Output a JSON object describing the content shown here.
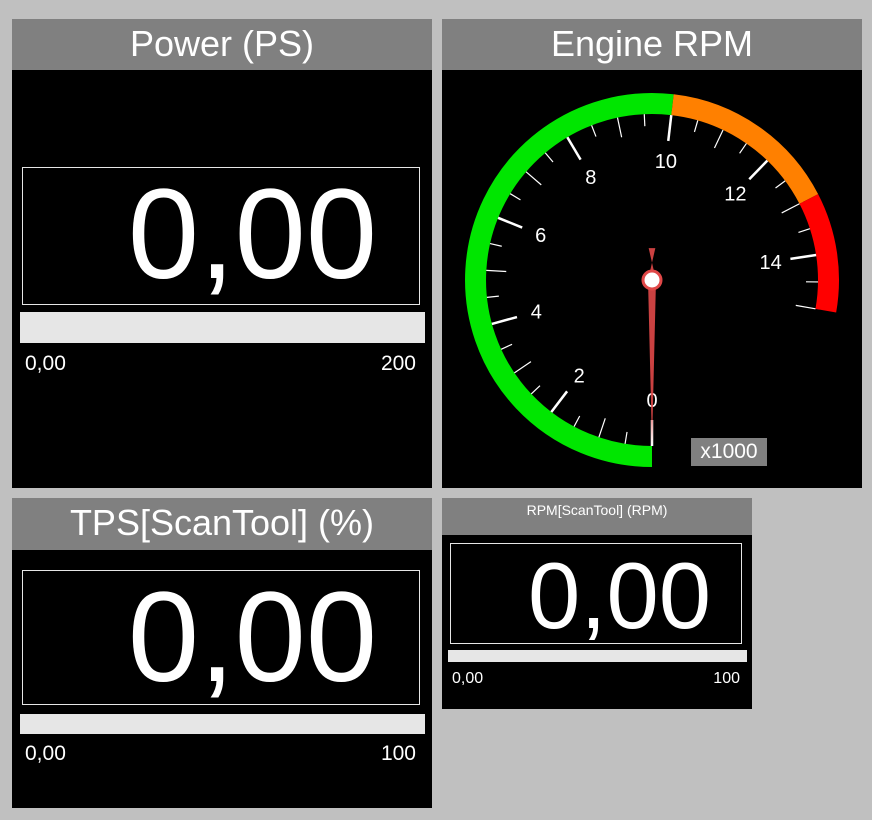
{
  "power": {
    "title": "Power (PS)",
    "value": "0,00",
    "min_label": "0,00",
    "max_label": "200",
    "level_percent": 0
  },
  "rpm_gauge": {
    "title": "Engine RPM",
    "unit_label": "x1000",
    "min": 0,
    "max": 15,
    "needle_value": 0,
    "tick_labels": [
      "0",
      "2",
      "4",
      "6",
      "8",
      "10",
      "12",
      "14"
    ],
    "zones": [
      {
        "from": 0,
        "to": 10,
        "color": "#00e600"
      },
      {
        "from": 10,
        "to": 13,
        "color": "#ff8000"
      },
      {
        "from": 13,
        "to": 15,
        "color": "#ff0000"
      }
    ],
    "needle_color": "#e04848"
  },
  "tps": {
    "title": "TPS[ScanTool] (%)",
    "value": "0,00",
    "min_label": "0,00",
    "max_label": "100",
    "level_percent": 0
  },
  "rpm_scantool": {
    "title": "RPM[ScanTool] (RPM)",
    "value": "0,00",
    "min_label": "0,00",
    "max_label": "100",
    "level_percent": 0
  }
}
